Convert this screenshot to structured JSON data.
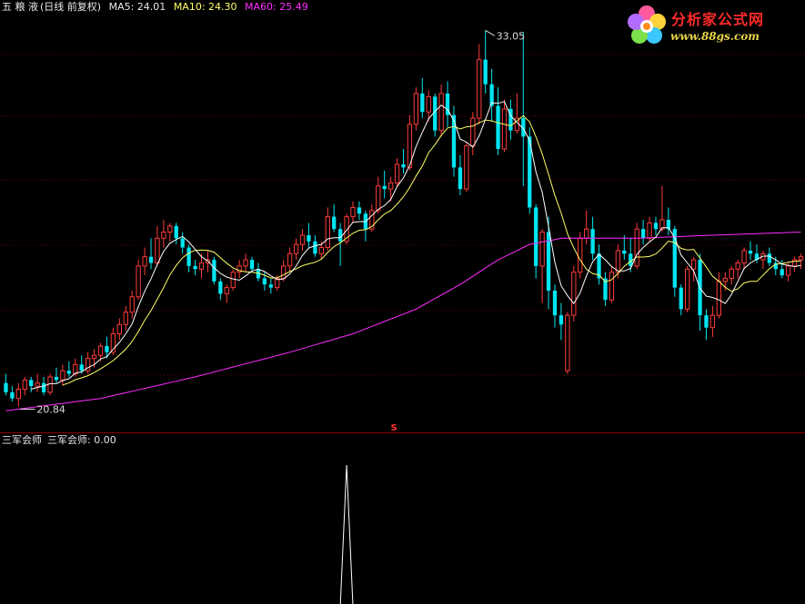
{
  "header": {
    "stock_name": "五 粮 液",
    "period": "(日线 前复权)",
    "ma5": "MA5: 24.01",
    "ma10": "MA10: 24.30",
    "ma60": "MA60: 25.49"
  },
  "sub_header": {
    "indicator_label": "三军会师",
    "indicator_value": "三军会师: 0.00"
  },
  "logo": {
    "title": "分析家公式网",
    "url": "www.88gs.com"
  },
  "annotations": {
    "high_label": "33.05",
    "low_label": "20.84",
    "signal_marker": "S"
  },
  "colors": {
    "up": "#ff3b3b",
    "down": "#00e5f2",
    "ma5": "#ffffff",
    "ma10": "#ffff66",
    "ma60": "#ff2cff",
    "axis": "#8b0000",
    "indicator": "#ffffff"
  },
  "chart_data": [
    {
      "type": "candlestick",
      "grid": "dotted-horizontal",
      "ylim": [
        20.0,
        33.8
      ],
      "candles": [
        [
          21.6,
          21.9,
          21.2,
          21.3
        ],
        [
          21.3,
          21.5,
          21.0,
          21.1
        ],
        [
          21.1,
          21.6,
          20.84,
          21.4
        ],
        [
          21.4,
          21.8,
          21.2,
          21.7
        ],
        [
          21.7,
          21.8,
          21.3,
          21.5
        ],
        [
          21.5,
          21.9,
          21.3,
          21.6
        ],
        [
          21.6,
          21.8,
          21.2,
          21.3
        ],
        [
          21.3,
          21.9,
          21.2,
          21.8
        ],
        [
          21.8,
          22.1,
          21.6,
          21.7
        ],
        [
          21.7,
          22.2,
          21.5,
          22.0
        ],
        [
          22.0,
          22.3,
          21.8,
          21.9
        ],
        [
          21.9,
          22.4,
          21.8,
          22.2
        ],
        [
          22.2,
          22.5,
          21.9,
          22.0
        ],
        [
          22.0,
          22.6,
          21.9,
          22.4
        ],
        [
          22.4,
          22.7,
          22.1,
          22.5
        ],
        [
          22.5,
          22.9,
          22.3,
          22.8
        ],
        [
          22.8,
          23.1,
          22.4,
          22.6
        ],
        [
          22.6,
          23.4,
          22.5,
          23.2
        ],
        [
          23.2,
          23.7,
          23.0,
          23.5
        ],
        [
          23.5,
          24.1,
          23.3,
          23.9
        ],
        [
          23.9,
          24.6,
          23.7,
          24.4
        ],
        [
          24.4,
          25.6,
          24.3,
          25.4
        ],
        [
          25.4,
          26.0,
          25.1,
          25.7
        ],
        [
          25.7,
          26.3,
          25.3,
          25.5
        ],
        [
          25.5,
          26.7,
          25.4,
          26.3
        ],
        [
          26.3,
          26.9,
          26.0,
          26.5
        ],
        [
          26.5,
          26.8,
          26.2,
          26.7
        ],
        [
          26.7,
          26.8,
          26.1,
          26.3
        ],
        [
          26.3,
          26.5,
          25.8,
          26.0
        ],
        [
          26.0,
          26.1,
          25.2,
          25.4
        ],
        [
          25.4,
          25.6,
          25.1,
          25.3
        ],
        [
          25.3,
          25.8,
          25.0,
          25.5
        ],
        [
          25.5,
          25.9,
          25.2,
          25.6
        ],
        [
          25.6,
          25.7,
          24.8,
          24.9
        ],
        [
          24.9,
          25.0,
          24.3,
          24.5
        ],
        [
          24.5,
          24.8,
          24.2,
          24.7
        ],
        [
          24.7,
          25.3,
          24.6,
          25.2
        ],
        [
          25.2,
          25.6,
          25.0,
          25.4
        ],
        [
          25.4,
          25.8,
          25.2,
          25.6
        ],
        [
          25.6,
          25.7,
          25.2,
          25.3
        ],
        [
          25.3,
          25.5,
          24.9,
          25.0
        ],
        [
          25.0,
          25.2,
          24.6,
          24.8
        ],
        [
          24.8,
          25.0,
          24.5,
          24.7
        ],
        [
          24.7,
          25.1,
          24.6,
          25.0
        ],
        [
          25.0,
          25.6,
          24.9,
          25.4
        ],
        [
          25.4,
          26.0,
          25.2,
          25.8
        ],
        [
          25.8,
          26.3,
          25.6,
          26.1
        ],
        [
          26.1,
          26.6,
          25.9,
          26.4
        ],
        [
          26.4,
          26.8,
          26.0,
          26.2
        ],
        [
          26.2,
          26.4,
          25.7,
          25.8
        ],
        [
          25.8,
          26.2,
          25.6,
          26.0
        ],
        [
          26.0,
          27.3,
          25.9,
          27.0
        ],
        [
          27.0,
          27.4,
          26.5,
          26.6
        ],
        [
          26.6,
          26.8,
          25.4,
          26.2
        ],
        [
          26.2,
          27.1,
          26.1,
          27.0
        ],
        [
          27.0,
          27.5,
          26.8,
          27.3
        ],
        [
          27.3,
          27.5,
          26.9,
          27.1
        ],
        [
          27.1,
          27.2,
          26.2,
          26.6
        ],
        [
          26.6,
          27.4,
          26.5,
          27.2
        ],
        [
          27.2,
          28.3,
          27.1,
          28.0
        ],
        [
          28.0,
          28.5,
          27.6,
          27.9
        ],
        [
          27.9,
          28.3,
          27.5,
          28.1
        ],
        [
          28.1,
          28.9,
          28.0,
          28.7
        ],
        [
          28.7,
          29.2,
          28.4,
          28.6
        ],
        [
          28.6,
          30.3,
          28.5,
          30.0
        ],
        [
          30.0,
          31.2,
          29.8,
          31.0
        ],
        [
          31.0,
          31.5,
          30.2,
          30.4
        ],
        [
          30.4,
          31.1,
          30.1,
          30.9
        ],
        [
          30.9,
          31.0,
          29.6,
          29.8
        ],
        [
          29.8,
          31.3,
          29.6,
          31.0
        ],
        [
          31.0,
          31.4,
          29.9,
          30.3
        ],
        [
          30.3,
          30.6,
          28.3,
          28.6
        ],
        [
          28.6,
          29.0,
          27.7,
          27.9
        ],
        [
          27.9,
          29.4,
          27.8,
          29.3
        ],
        [
          29.3,
          30.4,
          29.0,
          30.2
        ],
        [
          30.2,
          32.6,
          30.0,
          32.1
        ],
        [
          32.1,
          33.05,
          31.0,
          31.3
        ],
        [
          31.3,
          31.8,
          30.1,
          30.6
        ],
        [
          30.6,
          31.2,
          29.0,
          29.2
        ],
        [
          29.2,
          30.8,
          29.1,
          30.5
        ],
        [
          30.5,
          30.8,
          29.5,
          29.8
        ],
        [
          29.8,
          31.0,
          29.7,
          30.2
        ],
        [
          30.2,
          33.0,
          28.0,
          29.6
        ],
        [
          29.6,
          29.9,
          27.1,
          27.3
        ],
        [
          27.3,
          27.4,
          25.0,
          25.4
        ],
        [
          25.4,
          26.6,
          24.2,
          26.5
        ],
        [
          26.5,
          27.0,
          24.0,
          24.6
        ],
        [
          24.6,
          24.8,
          23.4,
          23.8
        ],
        [
          23.8,
          24.2,
          23.0,
          23.5
        ],
        [
          22.0,
          23.9,
          21.9,
          23.8
        ],
        [
          23.8,
          25.4,
          23.6,
          25.2
        ],
        [
          25.2,
          26.5,
          25.0,
          26.3
        ],
        [
          26.3,
          27.2,
          26.1,
          26.6
        ],
        [
          26.6,
          27.0,
          25.6,
          25.8
        ],
        [
          25.8,
          26.1,
          24.8,
          25.0
        ],
        [
          25.0,
          25.2,
          24.1,
          24.3
        ],
        [
          24.3,
          25.4,
          24.2,
          25.2
        ],
        [
          25.2,
          26.1,
          25.0,
          25.9
        ],
        [
          25.9,
          26.4,
          25.6,
          25.8
        ],
        [
          25.8,
          26.3,
          25.2,
          25.4
        ],
        [
          25.4,
          26.8,
          25.3,
          26.6
        ],
        [
          26.6,
          26.9,
          26.1,
          26.3
        ],
        [
          26.3,
          27.0,
          26.2,
          26.8
        ],
        [
          26.8,
          27.0,
          26.4,
          26.6
        ],
        [
          26.6,
          28.0,
          26.5,
          26.9
        ],
        [
          26.9,
          27.3,
          26.4,
          26.6
        ],
        [
          26.6,
          26.7,
          24.4,
          24.7
        ],
        [
          24.7,
          24.8,
          23.8,
          24.0
        ],
        [
          24.0,
          25.4,
          23.9,
          25.3
        ],
        [
          25.3,
          25.7,
          24.9,
          25.6
        ],
        [
          25.6,
          25.8,
          23.3,
          23.8
        ],
        [
          23.8,
          24.0,
          23.0,
          23.4
        ],
        [
          23.4,
          24.1,
          23.1,
          23.8
        ],
        [
          23.8,
          25.2,
          23.7,
          24.9
        ],
        [
          24.9,
          25.2,
          24.6,
          25.0
        ],
        [
          25.0,
          25.4,
          24.8,
          25.3
        ],
        [
          25.3,
          25.6,
          25.0,
          25.5
        ],
        [
          25.5,
          26.0,
          25.3,
          25.9
        ],
        [
          25.9,
          26.2,
          25.6,
          25.8
        ],
        [
          25.8,
          26.1,
          25.5,
          25.6
        ],
        [
          25.6,
          25.9,
          25.3,
          25.8
        ],
        [
          25.8,
          26.0,
          25.4,
          25.5
        ],
        [
          25.5,
          25.7,
          25.1,
          25.3
        ],
        [
          25.3,
          25.6,
          25.0,
          25.1
        ],
        [
          25.1,
          25.5,
          24.9,
          25.4
        ],
        [
          25.4,
          25.7,
          25.2,
          25.6
        ],
        [
          25.6,
          25.8,
          25.3,
          25.7
        ]
      ],
      "ma60": [
        [
          0,
          20.7
        ],
        [
          15,
          21.1
        ],
        [
          30,
          21.8
        ],
        [
          45,
          22.6
        ],
        [
          55,
          23.2
        ],
        [
          65,
          24.0
        ],
        [
          72,
          24.8
        ],
        [
          78,
          25.6
        ],
        [
          83,
          26.1
        ],
        [
          88,
          26.3
        ],
        [
          100,
          26.3
        ],
        [
          112,
          26.4
        ],
        [
          126,
          26.5
        ]
      ]
    },
    {
      "type": "line",
      "name": "三军会师",
      "note_values": "0 everywhere except a single spike",
      "spike_index": 54,
      "spike_value": 1.0,
      "ylim": [
        0,
        1.0
      ],
      "length": 127
    }
  ]
}
